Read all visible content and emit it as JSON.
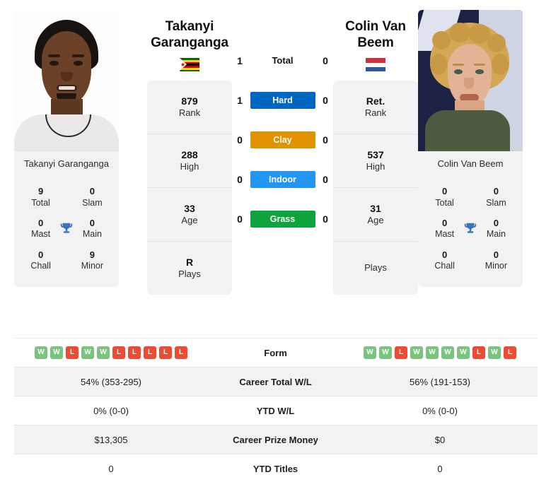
{
  "players": {
    "left": {
      "name_line1": "Takanyi",
      "name_line2": "Garanganga",
      "full_name": "Takanyi Garanganga",
      "country": "Zimbabwe",
      "flag": "zw-flag-icon",
      "rank": "879",
      "rank_label": "Rank",
      "high": "288",
      "high_label": "High",
      "age": "33",
      "age_label": "Age",
      "plays": "R",
      "plays_label": "Plays",
      "titles": {
        "total": "9",
        "total_label": "Total",
        "slam": "0",
        "slam_label": "Slam",
        "mast": "0",
        "mast_label": "Mast",
        "main": "0",
        "main_label": "Main",
        "chall": "0",
        "chall_label": "Chall",
        "minor": "9",
        "minor_label": "Minor"
      },
      "form": [
        "W",
        "W",
        "L",
        "W",
        "W",
        "L",
        "L",
        "L",
        "L",
        "L"
      ],
      "career_total_wl": "54% (353-295)",
      "ytd_wl": "0% (0-0)",
      "career_prize_money": "$13,305",
      "ytd_titles": "0"
    },
    "right": {
      "name_line1": "Colin Van",
      "name_line2": "Beem",
      "full_name": "Colin Van Beem",
      "country": "Netherlands",
      "flag": "nl-flag-icon",
      "rank": "Ret.",
      "rank_label": "Rank",
      "high": "537",
      "high_label": "High",
      "age": "31",
      "age_label": "Age",
      "plays": "",
      "plays_label": "Plays",
      "titles": {
        "total": "0",
        "total_label": "Total",
        "slam": "0",
        "slam_label": "Slam",
        "mast": "0",
        "mast_label": "Mast",
        "main": "0",
        "main_label": "Main",
        "chall": "0",
        "chall_label": "Chall",
        "minor": "0",
        "minor_label": "Minor"
      },
      "form": [
        "W",
        "W",
        "L",
        "W",
        "W",
        "W",
        "W",
        "L",
        "W",
        "L"
      ],
      "career_total_wl": "56% (191-153)",
      "ytd_wl": "0% (0-0)",
      "career_prize_money": "$0",
      "ytd_titles": "0"
    }
  },
  "surfaces": [
    {
      "label": "Total",
      "left": "1",
      "right": "0",
      "color": ""
    },
    {
      "label": "Hard",
      "left": "1",
      "right": "0",
      "color": "#0066bf"
    },
    {
      "label": "Clay",
      "left": "0",
      "right": "0",
      "color": "#e09200"
    },
    {
      "label": "Indoor",
      "left": "0",
      "right": "0",
      "color": "#2196f3"
    },
    {
      "label": "Grass",
      "left": "0",
      "right": "0",
      "color": "#0ea33c"
    }
  ],
  "table": {
    "rows": [
      {
        "label": "Form"
      },
      {
        "label": "Career Total W/L"
      },
      {
        "label": "YTD W/L"
      },
      {
        "label": "Career Prize Money"
      },
      {
        "label": "YTD Titles"
      }
    ]
  },
  "colors": {
    "hard": "#0066bf",
    "clay": "#e09200",
    "indoor": "#2196f3",
    "grass": "#0ea33c",
    "win": "#7ac47f",
    "loss": "#ef4a33",
    "trophy": "#3a73b8",
    "card_bg": "#f2f2f2"
  }
}
